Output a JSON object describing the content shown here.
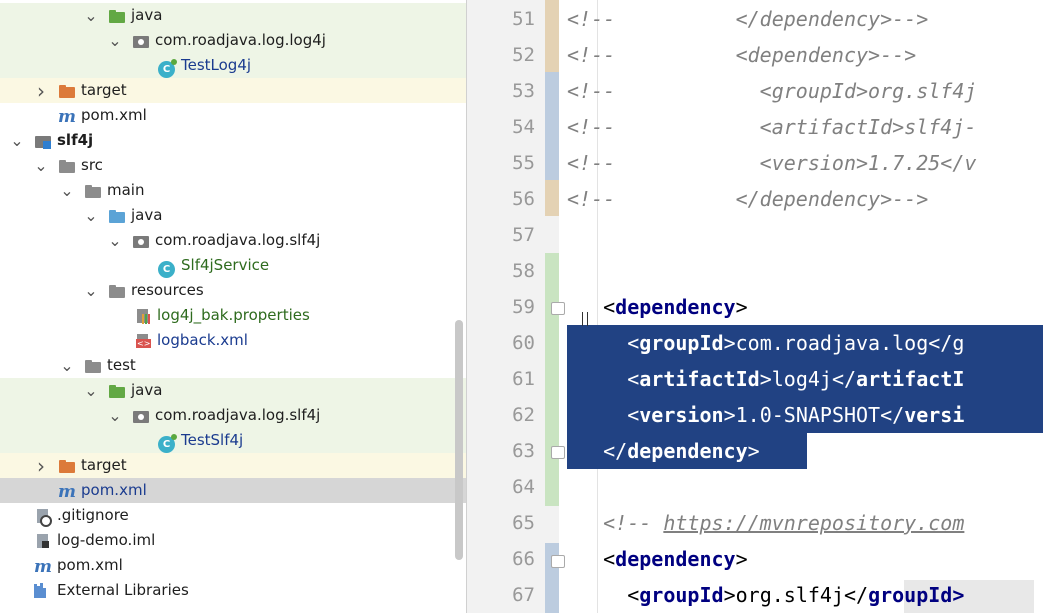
{
  "tree": {
    "rows": [
      {
        "label": "java",
        "icon": "folder-green",
        "arrow": "down",
        "indent": 84,
        "bg": "green"
      },
      {
        "label": "com.roadjava.log.log4j",
        "icon": "package",
        "arrow": "down",
        "indent": 108,
        "bg": "green"
      },
      {
        "label": "TestLog4j",
        "icon": "class-test",
        "arrow": "none",
        "indent": 134,
        "bg": "green",
        "color": "blue"
      },
      {
        "label": "target",
        "icon": "folder-orange",
        "arrow": "right",
        "indent": 34,
        "bg": "yellow"
      },
      {
        "label": "pom.xml",
        "icon": "maven",
        "arrow": "none",
        "indent": 34,
        "bg": ""
      },
      {
        "label": "slf4j",
        "icon": "module",
        "arrow": "down",
        "indent": 10,
        "bg": "",
        "bold": true
      },
      {
        "label": "src",
        "icon": "folder-gray",
        "arrow": "down",
        "indent": 34,
        "bg": ""
      },
      {
        "label": "main",
        "icon": "folder-gray",
        "arrow": "down",
        "indent": 60,
        "bg": ""
      },
      {
        "label": "java",
        "icon": "folder-blue",
        "arrow": "down",
        "indent": 84,
        "bg": ""
      },
      {
        "label": "com.roadjava.log.slf4j",
        "icon": "package",
        "arrow": "down",
        "indent": 108,
        "bg": ""
      },
      {
        "label": "Slf4jService",
        "icon": "class",
        "arrow": "none",
        "indent": 134,
        "bg": "",
        "color": "green"
      },
      {
        "label": "resources",
        "icon": "folder-res",
        "arrow": "down",
        "indent": 84,
        "bg": ""
      },
      {
        "label": "log4j_bak.properties",
        "icon": "props",
        "arrow": "none",
        "indent": 110,
        "bg": "",
        "color": "green"
      },
      {
        "label": "logback.xml",
        "icon": "xml",
        "arrow": "none",
        "indent": 110,
        "bg": "",
        "color": "blue"
      },
      {
        "label": "test",
        "icon": "folder-gray",
        "arrow": "down",
        "indent": 60,
        "bg": ""
      },
      {
        "label": "java",
        "icon": "folder-green",
        "arrow": "down",
        "indent": 84,
        "bg": "green"
      },
      {
        "label": "com.roadjava.log.slf4j",
        "icon": "package",
        "arrow": "down",
        "indent": 108,
        "bg": "green"
      },
      {
        "label": "TestSlf4j",
        "icon": "class-test",
        "arrow": "none",
        "indent": 134,
        "bg": "green",
        "color": "blue"
      },
      {
        "label": "target",
        "icon": "folder-orange",
        "arrow": "right",
        "indent": 34,
        "bg": "yellow"
      },
      {
        "label": "pom.xml",
        "icon": "maven",
        "arrow": "none",
        "indent": 34,
        "bg": "sel",
        "color": "blue"
      },
      {
        "label": ".gitignore",
        "icon": "git",
        "arrow": "none",
        "indent": 10,
        "bg": ""
      },
      {
        "label": "log-demo.iml",
        "icon": "iml",
        "arrow": "none",
        "indent": 10,
        "bg": ""
      },
      {
        "label": "pom.xml",
        "icon": "maven",
        "arrow": "none",
        "indent": 10,
        "bg": ""
      },
      {
        "label": "External Libraries",
        "icon": "libs",
        "arrow": "none",
        "indent": 10,
        "bg": ""
      }
    ]
  },
  "editor": {
    "lines": [
      {
        "n": "51",
        "text": "<!--          </dependency>-->",
        "kind": "comment"
      },
      {
        "n": "52",
        "text": "<!--          <dependency>-->",
        "kind": "comment"
      },
      {
        "n": "53",
        "text": "<!--            <groupId>org.slf4j",
        "kind": "comment"
      },
      {
        "n": "54",
        "text": "<!--            <artifactId>slf4j-",
        "kind": "comment"
      },
      {
        "n": "55",
        "text": "<!--            <version>1.7.25</v",
        "kind": "comment"
      },
      {
        "n": "56",
        "text": "<!--          </dependency>-->",
        "kind": "comment"
      },
      {
        "n": "57",
        "text": "",
        "kind": "plain"
      },
      {
        "n": "58",
        "text": "",
        "kind": "plain"
      },
      {
        "n": "59",
        "pre": "   ",
        "open": "<",
        "tagname": "dependency",
        "close": ">",
        "kind": "tag"
      },
      {
        "n": "60",
        "pre": "     ",
        "open": "<",
        "tagname": "groupId",
        "close": ">",
        "value": "com.roadjava.log</g",
        "kind": "tag-sel"
      },
      {
        "n": "61",
        "pre": "     ",
        "open": "<",
        "tagname": "artifactId",
        "close": ">",
        "value": "log4j</",
        "tail": "artifactI",
        "kind": "tag-sel"
      },
      {
        "n": "62",
        "pre": "     ",
        "open": "<",
        "tagname": "version",
        "close": ">",
        "value": "1.0-SNAPSHOT</",
        "tail": "versi",
        "kind": "tag-sel"
      },
      {
        "n": "63",
        "pre": "   ",
        "open": "</",
        "tagname": "dependency",
        "close": ">",
        "kind": "tag-sel-end"
      },
      {
        "n": "64",
        "text": "",
        "kind": "plain"
      },
      {
        "n": "65",
        "pre": "   ",
        "comment": "<!-- ",
        "link": "https://mvnrepository.com",
        "kind": "comment-link"
      },
      {
        "n": "66",
        "pre": "   ",
        "open": "<",
        "tagname": "dependency",
        "close": ">",
        "kind": "tag"
      },
      {
        "n": "67",
        "pre": "     ",
        "open": "<",
        "tagname": "groupId",
        "close": ">",
        "value": "org.slf4j</",
        "tail": "groupId>",
        "kind": "tag"
      }
    ]
  }
}
